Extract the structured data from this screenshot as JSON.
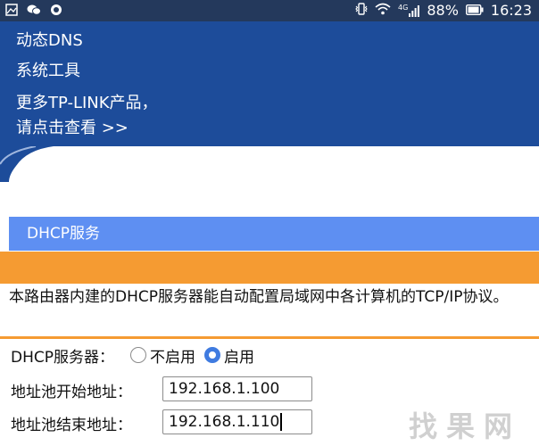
{
  "status_bar": {
    "battery_percent": "88%",
    "time": "16:23",
    "network_label": "4G",
    "left_icons": [
      "gallery-icon",
      "wechat-icon",
      "app-icon"
    ],
    "right_icons": [
      "vibrate-icon",
      "wifi-icon",
      "signal-icon",
      "battery-icon"
    ]
  },
  "menu": {
    "items": [
      "动态DNS",
      "系统工具",
      "更多TP-LINK产品，",
      "请点击查看 >>"
    ]
  },
  "section": {
    "title": "DHCP服务",
    "description": "本路由器内建的DHCP服务器能自动配置局域网中各计算机的TCP/IP协议。"
  },
  "form": {
    "dhcp_server_label": "DHCP服务器：",
    "option_disable": "不启用",
    "option_enable": "启用",
    "selected": "启用",
    "pool_start_label": "地址池开始地址：",
    "pool_start_value": "192.168.1.100",
    "pool_end_label": "地址池结束地址：",
    "pool_end_value": "192.168.1.110"
  },
  "watermark": {
    "text": "找果网"
  },
  "colors": {
    "status_bar_bg": "#24395c",
    "menu_bg": "#1d4c9a",
    "section_header_bg": "#5e8ff2",
    "accent_orange": "#f59b32",
    "radio_selected": "#3f7be0"
  }
}
